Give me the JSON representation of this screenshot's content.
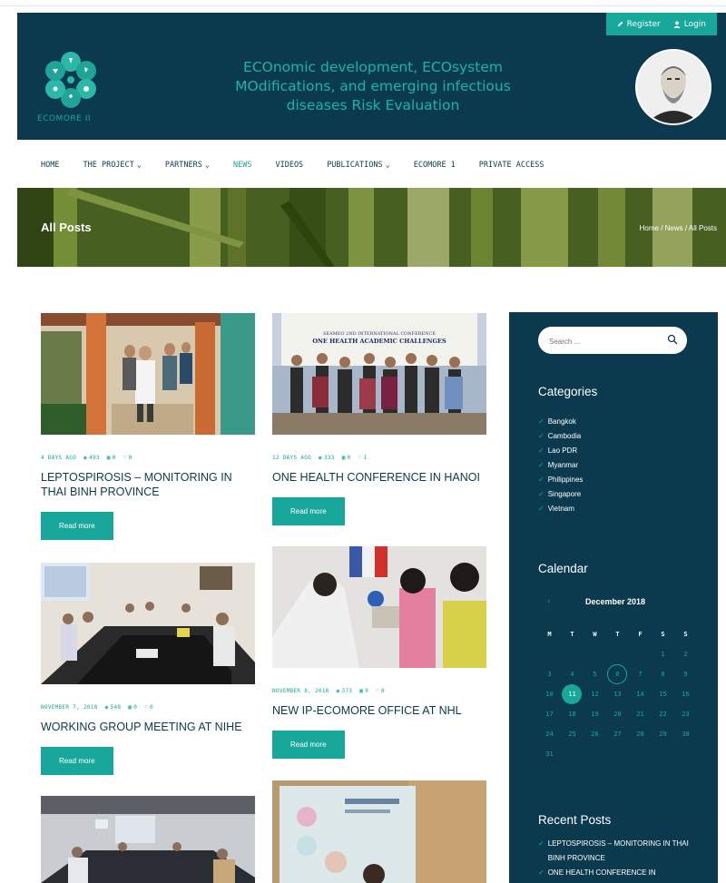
{
  "header": {
    "register_label": "Register",
    "login_label": "Login",
    "logo_text": "ECOMORE II",
    "title_line1": "ECOnomic development, ECOsystem",
    "title_line2": "MOdifications, and emerging infectious",
    "title_line3": "diseases Risk Evaluation"
  },
  "nav": {
    "home": "HOME",
    "project": "THE PROJECT",
    "partners": "PARTNERS",
    "news": "NEWS",
    "videos": "VIDEOS",
    "publications": "PUBLICATIONS",
    "ecomore1": "ECOMORE 1",
    "private": "PRIVATE ACCESS"
  },
  "banner": {
    "title": "All Posts",
    "breadcrumb": "Home  /  News  /  All Posts"
  },
  "posts": [
    {
      "date": "4 DAYS AGO",
      "views": "493",
      "comments": "0",
      "likes": "0",
      "title": "LEPTOSPIROSIS – MONITORING IN THAI BINH PROVINCE",
      "button": "Read more"
    },
    {
      "date": "12 DAYS AGO",
      "views": "333",
      "comments": "0",
      "likes": "1",
      "title": "ONE HEALTH CONFERENCE IN HANOI",
      "button": "Read more"
    },
    {
      "date": "NOVEMBER 7, 2018",
      "views": "548",
      "comments": "0",
      "likes": "0",
      "title": "WORKING GROUP MEETING AT NIHE",
      "button": "Read more"
    },
    {
      "date": "NOVEMBER 8, 2018",
      "views": "373",
      "comments": "0",
      "likes": "0",
      "title": "NEW IP-ECOMORE OFFICE AT NHL",
      "button": "Read more"
    }
  ],
  "poster_text": {
    "line1": "SEAMEO 2ND INTERNATIONAL CONFERENCE",
    "line2": "ONE HEALTH ACADEMIC CHALLENGES"
  },
  "sidebar": {
    "search_placeholder": "Search ...",
    "categories_title": "Categories",
    "categories": [
      "Bangkok",
      "Cambodia",
      "Lao PDR",
      "Myanmar",
      "Philippines",
      "Singapore",
      "Vietnam"
    ],
    "calendar_title": "Calendar",
    "month": "December 2018",
    "weekdays": [
      "M",
      "T",
      "W",
      "T",
      "F",
      "S",
      "S"
    ],
    "weeks": [
      [
        "",
        "",
        "",
        "",
        "",
        "1",
        "2"
      ],
      [
        "3",
        "4",
        "5",
        "6",
        "7",
        "8",
        "9"
      ],
      [
        "10",
        "11",
        "12",
        "13",
        "14",
        "15",
        "16"
      ],
      [
        "17",
        "18",
        "19",
        "20",
        "21",
        "22",
        "23"
      ],
      [
        "24",
        "25",
        "26",
        "27",
        "28",
        "29",
        "30"
      ],
      [
        "31",
        "",
        "",
        "",
        "",
        "",
        ""
      ]
    ],
    "today": "11",
    "highlighted": "6",
    "recent_title": "Recent Posts",
    "recent": [
      "LEPTOSPIROSIS – MONITORING IN THAI BINH PROVINCE",
      "ONE HEALTH CONFERENCE IN"
    ]
  },
  "colors": {
    "navy": "#0b3a4f",
    "teal": "#17a89b"
  }
}
